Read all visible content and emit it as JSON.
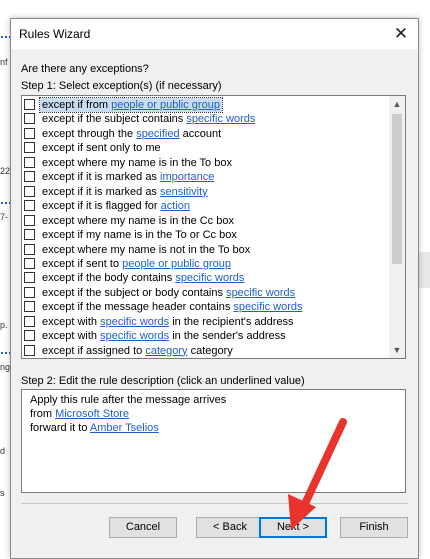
{
  "dialog": {
    "title": "Rules Wizard",
    "close_glyph": "✕",
    "question": "Are there any exceptions?",
    "step1_label": "Step 1: Select exception(s) (if necessary)",
    "exceptions": [
      {
        "pre": "except if from ",
        "link": "people or public group",
        "post": ""
      },
      {
        "pre": "except if the subject contains ",
        "link": "specific words",
        "post": ""
      },
      {
        "pre": "except through the ",
        "link": "specified",
        "post": " account"
      },
      {
        "pre": "except if sent only to me",
        "link": "",
        "post": ""
      },
      {
        "pre": "except where my name is in the To box",
        "link": "",
        "post": ""
      },
      {
        "pre": "except if it is marked as ",
        "link": "importance",
        "post": ""
      },
      {
        "pre": "except if it is marked as ",
        "link": "sensitivity",
        "post": ""
      },
      {
        "pre": "except if it is flagged for ",
        "link": "action",
        "post": ""
      },
      {
        "pre": "except where my name is in the Cc box",
        "link": "",
        "post": ""
      },
      {
        "pre": "except if my name is in the To or Cc box",
        "link": "",
        "post": ""
      },
      {
        "pre": "except where my name is not in the To box",
        "link": "",
        "post": ""
      },
      {
        "pre": "except if sent to ",
        "link": "people or public group",
        "post": ""
      },
      {
        "pre": "except if the body contains ",
        "link": "specific words",
        "post": ""
      },
      {
        "pre": "except if the subject or body contains ",
        "link": "specific words",
        "post": ""
      },
      {
        "pre": "except if the message header contains ",
        "link": "specific words",
        "post": ""
      },
      {
        "pre": "except with ",
        "link": "specific words",
        "post": " in the recipient's address"
      },
      {
        "pre": "except with ",
        "link": "specific words",
        "post": " in the sender's address"
      },
      {
        "pre": "except if assigned to ",
        "link": "category",
        "post": " category"
      }
    ],
    "step2_label": "Step 2: Edit the rule description (click an underlined value)",
    "description": {
      "line1": "Apply this rule after the message arrives",
      "line2_pre": "from ",
      "line2_link": "Microsoft Store",
      "line3_pre": "forward it to ",
      "line3_link": "Amber Tselios"
    },
    "buttons": {
      "cancel": "Cancel",
      "back": "< Back",
      "next": "Next >",
      "finish": "Finish"
    }
  },
  "background_fragments": [
    "nf",
    "22",
    "7-",
    "p.",
    "ng",
    "d",
    "s"
  ],
  "colors": {
    "link": "#1f5fc7",
    "selection": "#c8dcf2",
    "annotation_arrow": "#e8342c",
    "focus": "#0078d7"
  }
}
